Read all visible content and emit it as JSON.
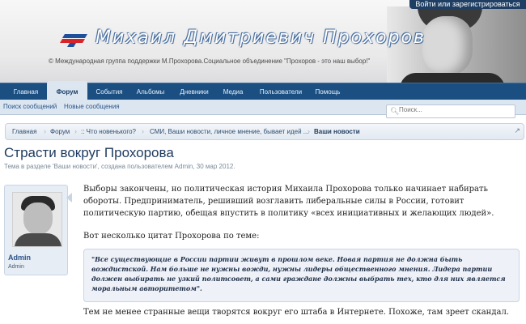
{
  "header": {
    "login_label": "Войти или зарегистрироваться",
    "title": "Михаил Дмитриевич Прохоров",
    "subtitle": "© Международная группа поддержки М.Прохорова.Социальное объединение \"Прохоров - это наш выбор!\""
  },
  "nav": {
    "tabs": [
      {
        "label": "Главная"
      },
      {
        "label": "Форум"
      },
      {
        "label": "События"
      },
      {
        "label": "Альбомы"
      },
      {
        "label": "Дневники"
      },
      {
        "label": "Медиа"
      },
      {
        "label": "Пользователи"
      },
      {
        "label": "Помощь"
      }
    ],
    "active_tab": "Форум"
  },
  "subnav": {
    "items": [
      {
        "label": "Поиск сообщений"
      },
      {
        "label": "Новые сообщения"
      }
    ]
  },
  "search": {
    "placeholder": "Поиск...",
    "icon": "search-icon"
  },
  "breadcrumb": {
    "items": [
      {
        "label": "Главная"
      },
      {
        "label": "Форум"
      },
      {
        "label": ":: Что новенького?"
      },
      {
        "label": "СМИ, Ваши новости, личное мнение, бывает идей ..."
      },
      {
        "label": "Ваши новости"
      }
    ],
    "jump_icon": "jump-arrow-icon"
  },
  "thread": {
    "title": "Страсти вокруг Прохорова",
    "meta": "Тема в разделе 'Ваши новости', создана пользователем Admin, 30 мар 2012."
  },
  "post": {
    "author": "Admin",
    "role": "Admin",
    "paragraph1": "Выборы закончены, но политическая история Михаила Прохорова только начинает набирать обороты. Предприниматель, решивший возглавить либеральные силы в России, готовит политическую партию, обещая впустить в политику «всех инициативных и желающих людей».",
    "paragraph2": "Вот несколько цитат Прохорова по теме:",
    "quote": "\"Все существующие в России партии живут в прошлом веке. Новая партия не должна быть вождистской. Нам больше не нужны вожди, нужны лидеры общественного мнения. Лидера партии должен выбирать не узкий политсовет, а сами граждане должны выбрать тех, кто для них является моральным авторитетом\".",
    "paragraph3": "Тем не менее странные вещи творятся вокруг его штаба в Интернете. Похоже, там зреет скандал."
  },
  "colors": {
    "nav_bg": "#1b4f82",
    "active_tab_bg": "#dce6f1",
    "title_color": "#1e3a5e",
    "link_color": "#2c5588"
  }
}
